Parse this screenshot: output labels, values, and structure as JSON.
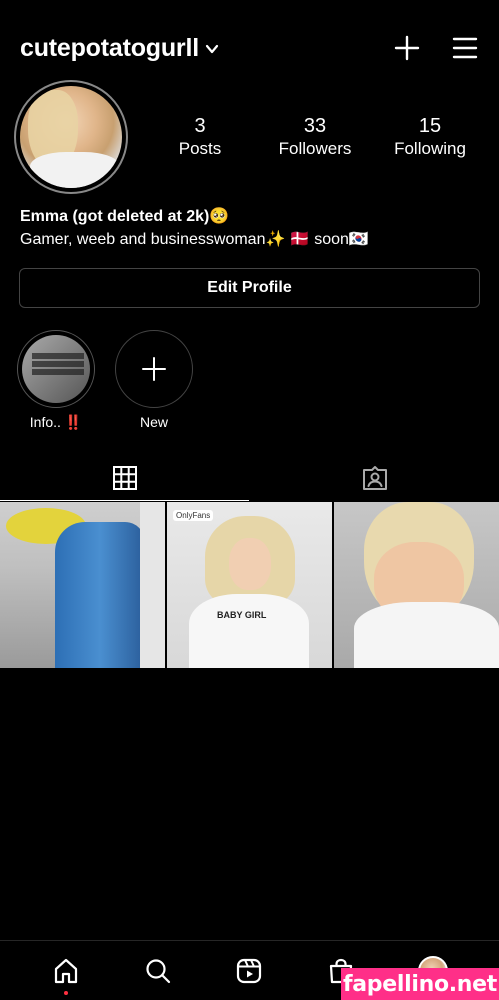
{
  "header": {
    "username": "cutepotatogurll"
  },
  "stats": [
    {
      "value": "3",
      "label": "Posts"
    },
    {
      "value": "33",
      "label": "Followers"
    },
    {
      "value": "15",
      "label": "Following"
    }
  ],
  "bio": {
    "name": "Emma (got deleted at 2k)🥺",
    "line": "Gamer, weeb and businesswoman✨  🇩🇰 soon🇰🇷"
  },
  "edit_profile_label": "Edit Profile",
  "highlights": [
    {
      "label": "Info.. ‼️"
    },
    {
      "label": "New"
    }
  ],
  "posts": [
    {
      "caption": ""
    },
    {
      "caption": "BABY GIRL",
      "logo": "OnlyFans"
    },
    {
      "caption": ""
    }
  ],
  "watermark": "fapellino.net",
  "icons": {
    "top": [
      "chevron-down-icon",
      "plus-icon",
      "menu-icon"
    ],
    "tabs": [
      "grid-icon",
      "tagged-icon"
    ],
    "bottom": [
      "home-icon",
      "search-icon",
      "reels-icon",
      "shop-icon",
      "profile-avatar"
    ]
  }
}
